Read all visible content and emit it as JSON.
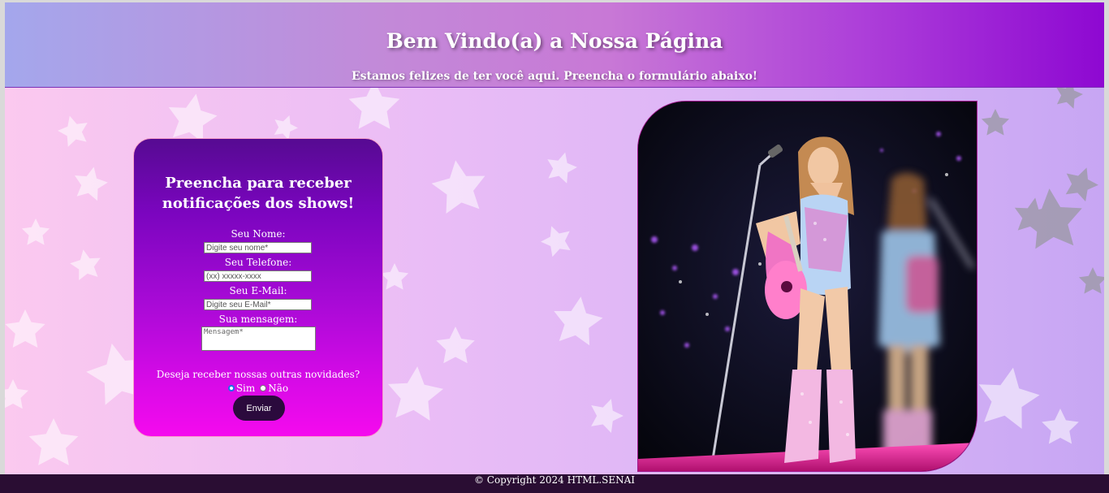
{
  "header": {
    "title": "Bem Vindo(a) a Nossa Página",
    "subtitle": "Estamos felizes de ter você aqui. Preencha o formulário abaixo!"
  },
  "form": {
    "title_line1": "Preencha para receber",
    "title_line2": "notificações dos shows!",
    "name_label": "Seu Nome:",
    "name_placeholder": "Digite seu nome*",
    "phone_label": "Seu Telefone:",
    "phone_placeholder": "(xx) xxxxx-xxxx",
    "email_label": "Seu E-Mail:",
    "email_placeholder": "Digite seu E-Mail*",
    "message_label": "Sua mensagem:",
    "message_placeholder": "Mensagem*",
    "question": "Deseja receber nossas outras novidades?",
    "option_yes": "Sim",
    "option_no": "Não",
    "selected_option": "Sim",
    "submit_label": "Enviar"
  },
  "footer": {
    "copyright": "© Copyright 2024 HTML.SENAI"
  },
  "colors": {
    "header_end": "#8e08d2",
    "form_top": "#560a92",
    "form_bottom": "#f50aee",
    "button_bg": "#2b0a3d",
    "footer_bg": "#2a0d33"
  }
}
